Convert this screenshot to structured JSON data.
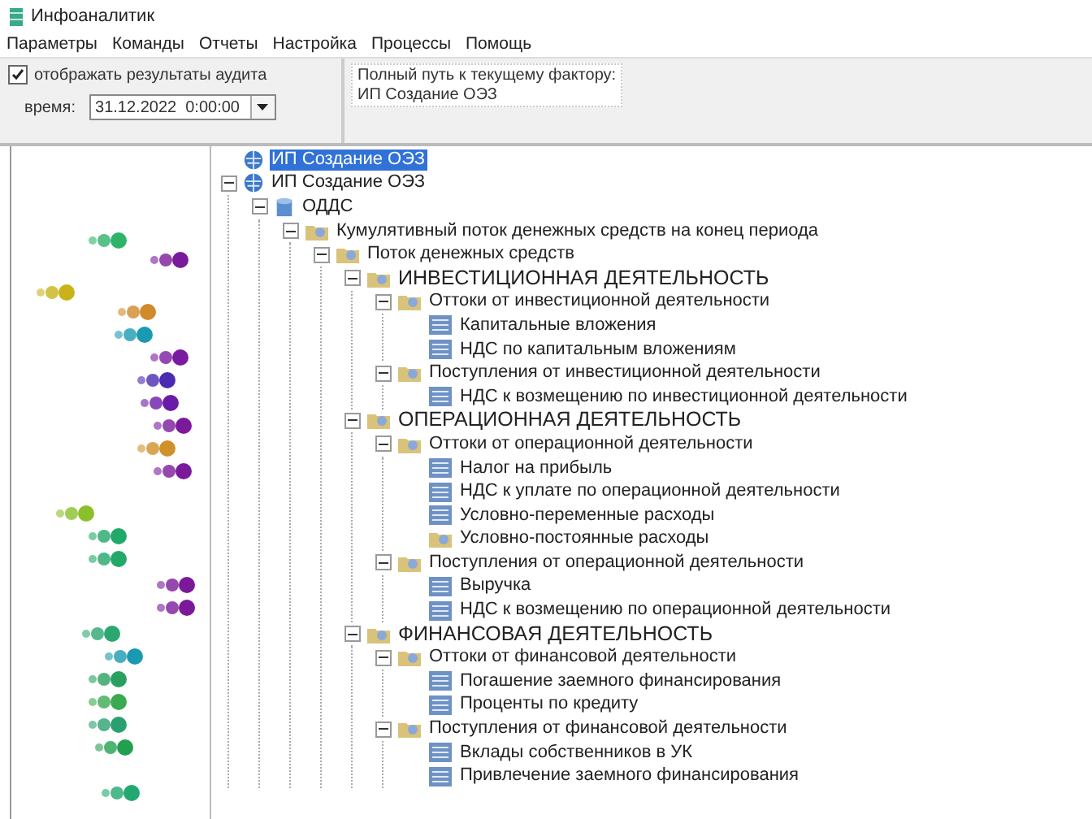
{
  "window": {
    "title": "Инфоаналитик"
  },
  "menu": [
    "Параметры",
    "Команды",
    "Отчеты",
    "Настройка",
    "Процессы",
    "Помощь"
  ],
  "options": {
    "show_audit": {
      "label": "отображать результаты аудита",
      "checked": true
    },
    "time": {
      "label": "время:",
      "value": "31.12.2022  0:00:00"
    }
  },
  "path": {
    "label": "Полный путь к текущему фактору:",
    "value": "ИП Создание ОЭЗ"
  },
  "tree": [
    {
      "label": "ИП Создание ОЭЗ",
      "kind": "globe",
      "selected": true
    },
    {
      "label": "ИП Создание ОЭЗ",
      "kind": "globe",
      "selected": false,
      "expanded": true,
      "children": [
        {
          "label": "ОДДС",
          "kind": "database",
          "selected": false,
          "expanded": true,
          "children": [
            {
              "label": "Кумулятивный поток денежных средств на конец периода",
              "kind": "folder",
              "selected": false,
              "expanded": true,
              "children": [
                {
                  "label": "Поток денежных средств",
                  "kind": "folder",
                  "selected": false,
                  "expanded": true,
                  "children": [
                    {
                      "label": "ИНВЕСТИЦИОННАЯ ДЕЯТЕЛЬНОСТЬ",
                      "kind": "section",
                      "selected": false,
                      "expanded": true,
                      "children": [
                        {
                          "label": "Оттоки от инвестиционной деятельности",
                          "kind": "folder",
                          "selected": false,
                          "expanded": true,
                          "children": [
                            {
                              "label": "Капитальные вложения",
                              "kind": "document",
                              "selected": false
                            },
                            {
                              "label": "НДС по капитальным вложениям",
                              "kind": "document",
                              "selected": false
                            }
                          ]
                        },
                        {
                          "label": "Поступления от инвестиционной деятельности",
                          "kind": "folder",
                          "selected": false,
                          "expanded": true,
                          "children": [
                            {
                              "label": "НДС к возмещению по инвестиционной деятельности",
                              "kind": "document",
                              "selected": false
                            }
                          ]
                        }
                      ]
                    },
                    {
                      "label": "ОПЕРАЦИОННАЯ ДЕЯТЕЛЬНОСТЬ",
                      "kind": "section",
                      "selected": false,
                      "expanded": true,
                      "children": [
                        {
                          "label": "Оттоки от операционной деятельности",
                          "kind": "folder",
                          "selected": false,
                          "expanded": true,
                          "children": [
                            {
                              "label": "Налог на прибыль",
                              "kind": "document",
                              "selected": false
                            },
                            {
                              "label": "НДС к уплате по операционной деятельности",
                              "kind": "document",
                              "selected": false
                            },
                            {
                              "label": "Условно-переменные расходы",
                              "kind": "document",
                              "selected": false
                            },
                            {
                              "label": "Условно-постоянные расходы",
                              "kind": "folder",
                              "selected": false
                            }
                          ]
                        },
                        {
                          "label": "Поступления от операционной деятельности",
                          "kind": "folder",
                          "selected": false,
                          "expanded": true,
                          "children": [
                            {
                              "label": "Выручка",
                              "kind": "document",
                              "selected": false
                            },
                            {
                              "label": "НДС к возмещению по операционной деятельности",
                              "kind": "document",
                              "selected": false
                            }
                          ]
                        }
                      ]
                    },
                    {
                      "label": "ФИНАНСОВАЯ ДЕЯТЕЛЬНОСТЬ",
                      "kind": "section",
                      "selected": false,
                      "expanded": true,
                      "children": [
                        {
                          "label": "Оттоки от финансовой деятельности",
                          "kind": "folder",
                          "selected": false,
                          "expanded": true,
                          "children": [
                            {
                              "label": "Погашение заемного финансирования",
                              "kind": "document",
                              "selected": false
                            },
                            {
                              "label": "Проценты по кредиту",
                              "kind": "document",
                              "selected": false
                            }
                          ]
                        },
                        {
                          "label": "Поступления от финансовой деятельности",
                          "kind": "folder",
                          "selected": false,
                          "expanded": true,
                          "children": [
                            {
                              "label": "Вклады собственников в УК",
                              "kind": "document",
                              "selected": false
                            },
                            {
                              "label": "Привлечение заемного финансирования",
                              "kind": "document",
                              "selected": false
                            }
                          ]
                        }
                      ]
                    }
                  ]
                }
              ]
            }
          ]
        }
      ]
    }
  ]
}
